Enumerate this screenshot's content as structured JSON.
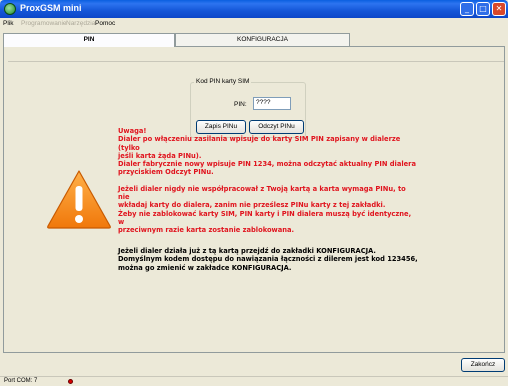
{
  "window": {
    "title": "ProxGSM  mini",
    "colors": {
      "titlebar": "#1456d8",
      "close": "#d9482b",
      "warning": "#e0141e"
    }
  },
  "menu": {
    "items": [
      {
        "label": "Plik",
        "enabled": true
      },
      {
        "label": "Programowanie",
        "enabled": false
      },
      {
        "label": "Narzędzia",
        "enabled": false
      },
      {
        "label": "Pomoc",
        "enabled": true
      }
    ]
  },
  "tabs": [
    {
      "label": "PIN",
      "active": true
    },
    {
      "label": "KONFIGURACJA",
      "active": false
    }
  ],
  "pin_group": {
    "legend": "Kod PIN karty SIM",
    "pin_label": "PIN:",
    "pin_value": "????",
    "write_button": "Zapis PINu",
    "read_button": "Odczyt PINu"
  },
  "warning": {
    "icon": "warning-triangle-icon",
    "lines_1": [
      "Uwaga!",
      "Dialer po włączeniu zasilania wpisuje do karty SIM PIN zapisany w dialerze (tylko",
      "jeśli karta żąda PINu).",
      "Dialer fabrycznie nowy wpisuje PIN 1234, można odczytać aktualny PIN dialera",
      "przyciskiem Odczyt PINu."
    ],
    "lines_2": [
      "Jeżeli dialer nigdy nie współpracował z Twoją kartą a karta wymaga PINu, to nie",
      "wkładaj karty do dialera, zanim nie prześlesz PINu karty z tej zakładki.",
      "Żeby nie zablokować karty SIM,  PIN karty i PIN dialera muszą być identyczne, w",
      "przeciwnym razie karta zostanie zablokowana."
    ]
  },
  "info": {
    "lines": [
      "Jeżeli dialer działa już z tą kartą przejdź  do zakładki KONFIGURACJA.",
      "Domyślnym kodem dostępu do nawiązania łączności z dilerem jest kod 123456,",
      "można go zmienić w zakładce KONFIGURACJA."
    ]
  },
  "close_button": "Zakończ",
  "status": {
    "port": "Port COM: 7",
    "led_color": "#d80000"
  }
}
